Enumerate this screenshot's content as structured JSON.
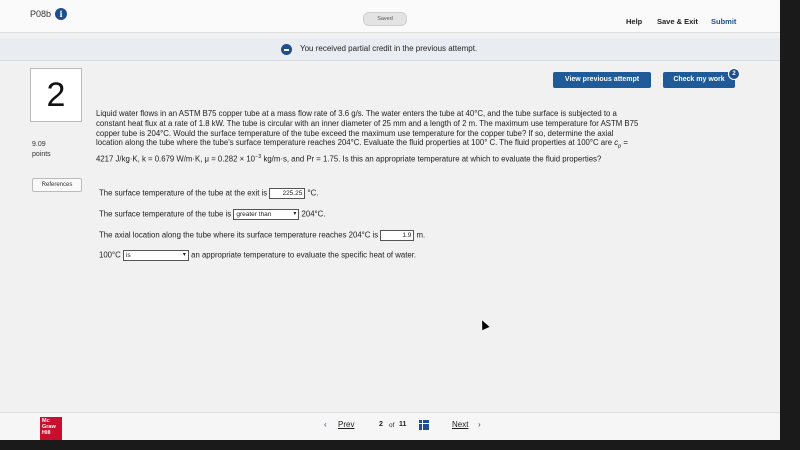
{
  "header": {
    "problem_id": "P08b",
    "saved_label": "Saved",
    "help_label": "Help",
    "save_exit_label": "Save & Exit",
    "submit_label": "Submit"
  },
  "banner": {
    "text": "You received partial credit in the previous attempt."
  },
  "question": {
    "number": "2",
    "points_value": "9.09",
    "points_label": "points",
    "references_label": "References",
    "view_previous_label": "View previous attempt",
    "check_work_label": "Check my work",
    "check_work_badge": "2",
    "text_line1": "Liquid water flows in an ASTM B75 copper tube at a mass flow rate of 3.6 g/s. The water enters the tube at 40°C, and the tube surface is subjected to a constant heat flux at a rate of 1.8 kW. The tube is circular with an inner diameter of 25 mm and a length of 2 m. The maximum use temperature for ASTM B75 copper tube is 204°C. Would the surface temperature of the tube exceed the maximum use temperature for the copper tube? If so, determine the axial location along the tube where the tube's surface temperature reaches 204°C. Evaluate the fluid properties at 100° C. The fluid properties at 100°C are ",
    "cp_symbol": "c",
    "cp_sub": "p",
    "text_line2": " = 4217 J/kg·K, k = 0.679 W/m·K, μ = 0.282 × 10",
    "mu_exp": "−3",
    "text_line3": " kg/m·s, and Pr = 1.75. Is this an appropriate temperature at which to evaluate the fluid properties?"
  },
  "answers": {
    "a1_prefix": "The surface temperature of the tube at the exit is",
    "a1_value": "225.25",
    "a1_suffix": "°C.",
    "a2_prefix": "The surface temperature of the tube is",
    "a2_value": "greater than",
    "a2_suffix": "204°C.",
    "a3_prefix": "The axial location along the tube where its surface temperature reaches 204°C is",
    "a3_value": "1.9",
    "a3_suffix": "m.",
    "a4_prefix": "100°C",
    "a4_value": "is",
    "a4_suffix": "an appropriate temperature to evaluate the specific heat of water."
  },
  "footer": {
    "logo_line1": "Mc",
    "logo_line2": "Graw",
    "logo_line3": "Hill",
    "prev_label": "Prev",
    "page_current": "2",
    "page_of": "of",
    "page_total": "11",
    "next_label": "Next"
  },
  "colors": {
    "accent": "#1f5a99",
    "brand_red": "#c8102e"
  }
}
